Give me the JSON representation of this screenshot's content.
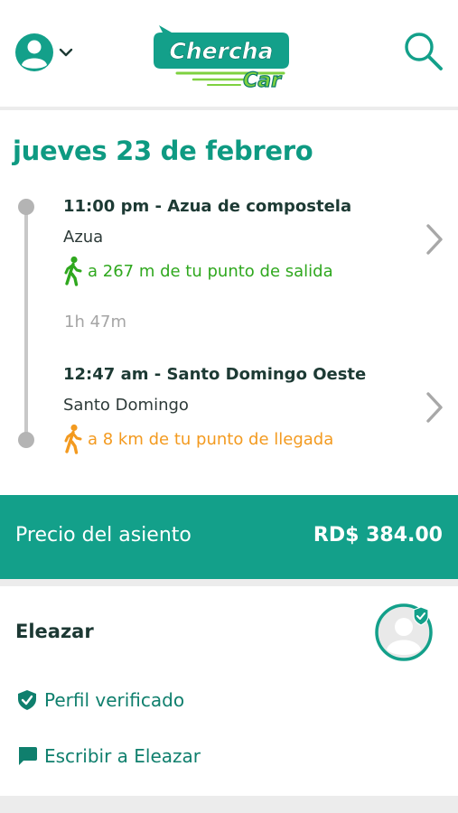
{
  "header": {
    "user_icon": "user-circle-icon",
    "dropdown_icon": "chevron-down-icon",
    "logo_text_top": "Chercha",
    "logo_text_bottom": "Car",
    "search_icon": "search-icon"
  },
  "trip": {
    "date": "jueves 23 de febrero",
    "origin": {
      "time_place": "11:00 pm - Azua de compostela",
      "city": "Azua",
      "walk_text": "a 267 m de tu punto de salida",
      "walk_color": "#2fa81e"
    },
    "duration": "1h 47m",
    "destination": {
      "time_place": "12:47 am - Santo Domingo Oeste",
      "city": "Santo Domingo",
      "walk_text": "a 8 km de tu punto de llegada",
      "walk_color": "#f39a1f"
    }
  },
  "price": {
    "label": "Precio del asiento",
    "value": "RD$ 384.00"
  },
  "driver": {
    "name": "Eleazar"
  },
  "actions": {
    "verified_label": "Perfil verificado",
    "write_label": "Escribir a Eleazar"
  },
  "colors": {
    "brand": "#13a08a",
    "title": "#0e9a82",
    "logo_green": "#7ed13f"
  }
}
